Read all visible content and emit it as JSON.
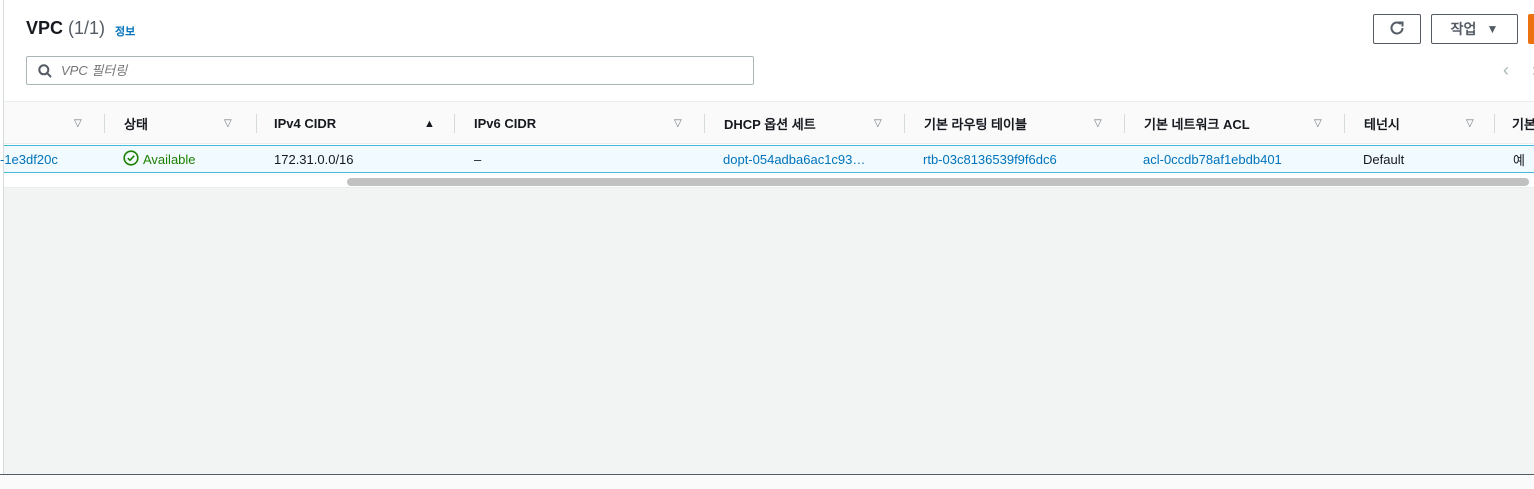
{
  "header": {
    "title": "VPC",
    "count": "(1/1)",
    "info_link": "정보",
    "refresh_icon": "refresh-icon",
    "actions_label": "작업",
    "actions_caret": "▼"
  },
  "search": {
    "placeholder": "VPC 필터링",
    "icon": "search-icon"
  },
  "pagination": {
    "prev": "‹",
    "next": "›"
  },
  "table": {
    "columns": [
      {
        "label": "",
        "sort": "▽"
      },
      {
        "label": "상태",
        "sort": "▽"
      },
      {
        "label": "IPv4 CIDR",
        "sort": "▲"
      },
      {
        "label": "IPv6 CIDR",
        "sort": "▽"
      },
      {
        "label": "DHCP 옵션 세트",
        "sort": "▽"
      },
      {
        "label": "기본 라우팅 테이블",
        "sort": "▽"
      },
      {
        "label": "기본 네트워크 ACL",
        "sort": "▽"
      },
      {
        "label": "테넌시",
        "sort": "▽"
      },
      {
        "label": "기본"
      }
    ],
    "rows": [
      {
        "vpc_id": "-1e3df20c",
        "status": "Available",
        "ipv4_cidr": "172.31.0.0/16",
        "ipv6_cidr": "–",
        "dhcp_options": "dopt-054adba6ac1c93…",
        "main_route_table": "rtb-03c8136539f9f6dc6",
        "main_network_acl": "acl-0ccdb78af1ebdb401",
        "tenancy": "Default",
        "default_vpc": "예"
      }
    ]
  },
  "colors": {
    "link": "#0073bb",
    "success": "#1d8102",
    "primary_button": "#ec7211",
    "selected_row_bg": "#f1faff",
    "selected_row_border": "#44b9d6"
  }
}
